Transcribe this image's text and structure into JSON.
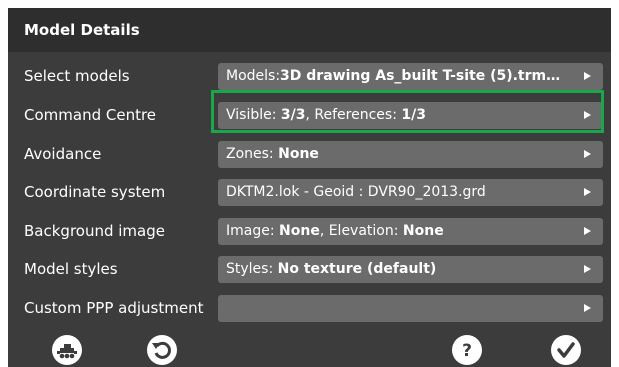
{
  "dialog": {
    "title": "Model Details"
  },
  "rows": [
    {
      "label": "Select models",
      "parts": [
        {
          "text": "Models:",
          "bold": false
        },
        {
          "text": "3D drawing As_built T-site (5).trm…",
          "bold": true
        }
      ]
    },
    {
      "label": "Command Centre",
      "parts": [
        {
          "text": "Visible: ",
          "bold": false
        },
        {
          "text": "3/3",
          "bold": true
        },
        {
          "text": ", References: ",
          "bold": false
        },
        {
          "text": "1/3",
          "bold": true
        }
      ]
    },
    {
      "label": "Avoidance",
      "parts": [
        {
          "text": "Zones: ",
          "bold": false
        },
        {
          "text": "None",
          "bold": true
        }
      ]
    },
    {
      "label": "Coordinate system",
      "parts": [
        {
          "text": "DKTM2.lok - Geoid : DVR90_2013.grd",
          "bold": false
        }
      ]
    },
    {
      "label": "Background image",
      "parts": [
        {
          "text": "Image: ",
          "bold": false
        },
        {
          "text": "None",
          "bold": true
        },
        {
          "text": ", Elevation: ",
          "bold": false
        },
        {
          "text": "None",
          "bold": true
        }
      ]
    },
    {
      "label": "Model styles",
      "parts": [
        {
          "text": "Styles: ",
          "bold": false
        },
        {
          "text": "No texture (default)",
          "bold": true
        }
      ]
    },
    {
      "label": "Custom PPP adjustment",
      "parts": []
    }
  ],
  "highlighted_row": "Command Centre",
  "colors": {
    "background": "#3c3c3c",
    "header": "#2e2e2e",
    "field": "#6b6b6b",
    "highlight": "#1aa64a",
    "text": "#ffffff"
  },
  "bottom_bar": {
    "left_icons": [
      "machine-icon",
      "reset-icon"
    ],
    "right_icons": [
      "help-icon",
      "confirm-icon"
    ]
  }
}
